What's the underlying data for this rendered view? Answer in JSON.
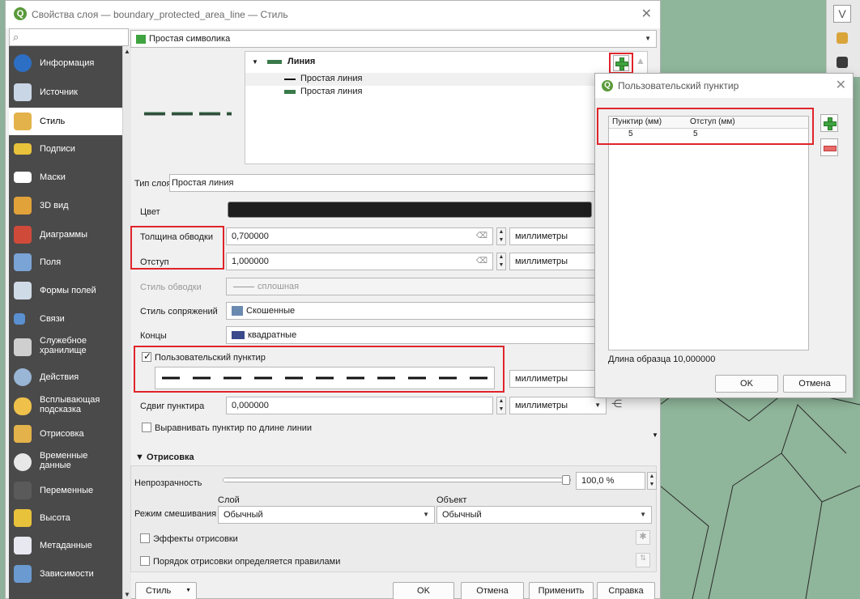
{
  "window": {
    "title": "Свойства слоя — boundary_protected_area_line — Стиль"
  },
  "renderer": {
    "value": "Простая символика"
  },
  "sidebar": {
    "items": [
      {
        "label": "Информация",
        "icon": "info-icon"
      },
      {
        "label": "Источник",
        "icon": "source-icon"
      },
      {
        "label": "Стиль",
        "icon": "style-brush-icon"
      },
      {
        "label": "Подписи",
        "icon": "labels-abc-icon"
      },
      {
        "label": "Маски",
        "icon": "masks-abc-icon"
      },
      {
        "label": "3D вид",
        "icon": "3d-cube-icon"
      },
      {
        "label": "Диаграммы",
        "icon": "diagram-icon"
      },
      {
        "label": "Поля",
        "icon": "fields-icon"
      },
      {
        "label": "Формы полей",
        "icon": "attributes-form-icon"
      },
      {
        "label": "Связи",
        "icon": "joins-icon"
      },
      {
        "label": "Служебное хранилище",
        "icon": "auxiliary-storage-icon"
      },
      {
        "label": "Действия",
        "icon": "actions-icon"
      },
      {
        "label": "Всплывающая подсказка",
        "icon": "maptip-icon"
      },
      {
        "label": "Отрисовка",
        "icon": "rendering-icon"
      },
      {
        "label": "Временные данные",
        "icon": "temporal-icon"
      },
      {
        "label": "Переменные",
        "icon": "variables-icon"
      },
      {
        "label": "Высота",
        "icon": "elevation-icon"
      },
      {
        "label": "Метаданные",
        "icon": "metadata-icon"
      },
      {
        "label": "Зависимости",
        "icon": "dependencies-icon"
      }
    ]
  },
  "symbol_tree": {
    "root": "Линия",
    "children": [
      "Простая линия",
      "Простая линия"
    ]
  },
  "layer_type": {
    "label": "Тип слоя",
    "value": "Простая линия"
  },
  "props": {
    "color_label": "Цвет",
    "color_value": "#1e1e1e",
    "stroke_width_label": "Толщина обводки",
    "stroke_width_value": "0,700000",
    "offset_label": "Отступ",
    "offset_value": "1,000000",
    "unit": "миллиметры",
    "stroke_style_label": "Стиль обводки",
    "stroke_style_value": "сплошная",
    "join_style_label": "Стиль сопряжений",
    "join_style_value": "Скошенные",
    "cap_style_label": "Концы",
    "cap_style_value": "квадратные",
    "custom_dash_label": "Пользовательский пунктир",
    "custom_dash_checked": true,
    "dash_offset_label": "Сдвиг пунктира",
    "dash_offset_value": "0,000000",
    "align_dash_label": "Выравнивать пунктир по длине линии"
  },
  "rendering": {
    "section_label": "Отрисовка",
    "opacity_label": "Непрозрачность",
    "opacity_value": "100,0 %",
    "opacity_fraction": 1.0,
    "blend_label": "Режим смешивания",
    "layer_label": "Слой",
    "object_label": "Объект",
    "layer_blend": "Обычный",
    "object_blend": "Обычный",
    "effects_label": "Эффекты отрисовки",
    "order_label": "Порядок отрисовки определяется правилами"
  },
  "footer": {
    "style_btn": "Стиль",
    "ok": "OK",
    "cancel": "Отмена",
    "apply": "Применить",
    "help": "Справка"
  },
  "dash_dialog": {
    "title": "Пользовательский пунктир",
    "col_dash": "Пунктир (мм)",
    "col_space": "Отступ (мм)",
    "rows": [
      {
        "dash": "5",
        "space": "5"
      }
    ],
    "pattern_length": "Длина образца 10,000000",
    "ok": "OK",
    "cancel": "Отмена"
  }
}
